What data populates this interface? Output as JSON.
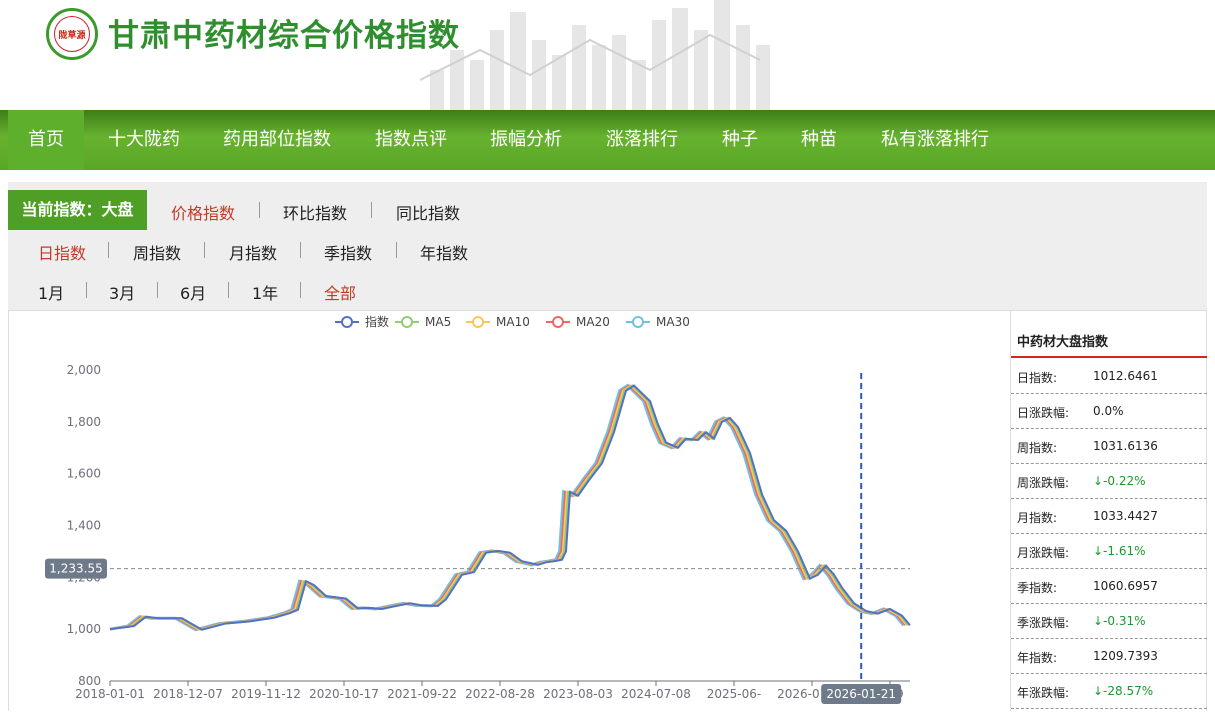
{
  "header": {
    "logo_text": "陇草源",
    "site_title": "甘肃中药材综合价格指数"
  },
  "nav": {
    "items": [
      "首页",
      "十大陇药",
      "药用部位指数",
      "指数点评",
      "振幅分析",
      "涨落排行",
      "种子",
      "种苗",
      "私有涨落排行"
    ],
    "active": "首页"
  },
  "filters": {
    "current_label": "当前指数：大盘",
    "index_types": [
      "价格指数",
      "环比指数",
      "同比指数"
    ],
    "index_types_selected": "价格指数",
    "periods": [
      "日指数",
      "周指数",
      "月指数",
      "季指数",
      "年指数"
    ],
    "periods_selected": "日指数",
    "ranges": [
      "1月",
      "3月",
      "6月",
      "1年",
      "全部"
    ],
    "ranges_selected": "全部"
  },
  "chart_data": {
    "type": "line",
    "legend": [
      "指数",
      "MA5",
      "MA10",
      "MA20",
      "MA30"
    ],
    "colors": {
      "指数": "#5470c6",
      "MA5": "#91cc75",
      "MA10": "#fac858",
      "MA20": "#ee6666",
      "MA30": "#73c0de"
    },
    "x_ticks": [
      "2018-01-01",
      "2018-12-07",
      "2019-11-12",
      "2020-10-17",
      "2021-09-22",
      "2022-08-28",
      "2023-08-03",
      "2024-07-08",
      "2025-06-",
      "2026-01-21",
      "5-19"
    ],
    "ylim": [
      800,
      2000
    ],
    "y_ticks": [
      800,
      1000,
      1200,
      1400,
      1600,
      1800,
      2000
    ],
    "crosshair_y_label": "1,233.55",
    "crosshair_x_label": "2026-01-21",
    "series_points": [
      [
        0,
        1000
      ],
      [
        0.03,
        1012
      ],
      [
        0.045,
        1048
      ],
      [
        0.06,
        1042
      ],
      [
        0.09,
        1042
      ],
      [
        0.115,
        998
      ],
      [
        0.145,
        1022
      ],
      [
        0.175,
        1030
      ],
      [
        0.205,
        1044
      ],
      [
        0.225,
        1062
      ],
      [
        0.235,
        1075
      ],
      [
        0.245,
        1185
      ],
      [
        0.255,
        1170
      ],
      [
        0.27,
        1128
      ],
      [
        0.295,
        1118
      ],
      [
        0.31,
        1080
      ],
      [
        0.325,
        1082
      ],
      [
        0.34,
        1078
      ],
      [
        0.355,
        1088
      ],
      [
        0.375,
        1100
      ],
      [
        0.39,
        1092
      ],
      [
        0.41,
        1090
      ],
      [
        0.42,
        1115
      ],
      [
        0.44,
        1210
      ],
      [
        0.455,
        1220
      ],
      [
        0.46,
        1245
      ],
      [
        0.47,
        1295
      ],
      [
        0.485,
        1302
      ],
      [
        0.5,
        1295
      ],
      [
        0.515,
        1262
      ],
      [
        0.535,
        1248
      ],
      [
        0.545,
        1258
      ],
      [
        0.555,
        1262
      ],
      [
        0.565,
        1268
      ],
      [
        0.57,
        1300
      ],
      [
        0.575,
        1530
      ],
      [
        0.585,
        1515
      ],
      [
        0.6,
        1580
      ],
      [
        0.615,
        1640
      ],
      [
        0.63,
        1760
      ],
      [
        0.645,
        1920
      ],
      [
        0.655,
        1940
      ],
      [
        0.665,
        1910
      ],
      [
        0.675,
        1880
      ],
      [
        0.685,
        1790
      ],
      [
        0.695,
        1720
      ],
      [
        0.71,
        1700
      ],
      [
        0.72,
        1735
      ],
      [
        0.735,
        1730
      ],
      [
        0.745,
        1760
      ],
      [
        0.755,
        1735
      ],
      [
        0.765,
        1800
      ],
      [
        0.775,
        1815
      ],
      [
        0.785,
        1780
      ],
      [
        0.8,
        1680
      ],
      [
        0.815,
        1520
      ],
      [
        0.83,
        1420
      ],
      [
        0.845,
        1380
      ],
      [
        0.86,
        1300
      ],
      [
        0.875,
        1195
      ],
      [
        0.885,
        1210
      ],
      [
        0.895,
        1245
      ],
      [
        0.905,
        1210
      ],
      [
        0.915,
        1160
      ],
      [
        0.93,
        1100
      ],
      [
        0.945,
        1070
      ],
      [
        0.96,
        1060
      ],
      [
        0.975,
        1078
      ],
      [
        0.99,
        1052
      ],
      [
        1.0,
        1015
      ]
    ]
  },
  "side": {
    "title": "中药材大盘指数",
    "rows": [
      {
        "k": "日指数:",
        "v": "1012.6461",
        "dir": ""
      },
      {
        "k": "日涨跌幅:",
        "v": "0.0%",
        "dir": ""
      },
      {
        "k": "周指数:",
        "v": "1031.6136",
        "dir": ""
      },
      {
        "k": "周涨跌幅:",
        "v": "↓-0.22%",
        "dir": "down"
      },
      {
        "k": "月指数:",
        "v": "1033.4427",
        "dir": ""
      },
      {
        "k": "月涨跌幅:",
        "v": "↓-1.61%",
        "dir": "down"
      },
      {
        "k": "季指数:",
        "v": "1060.6957",
        "dir": ""
      },
      {
        "k": "季涨跌幅:",
        "v": "↓-0.31%",
        "dir": "down"
      },
      {
        "k": "年指数:",
        "v": "1209.7393",
        "dir": ""
      },
      {
        "k": "年涨跌幅:",
        "v": "↓-28.57%",
        "dir": "down"
      }
    ]
  }
}
